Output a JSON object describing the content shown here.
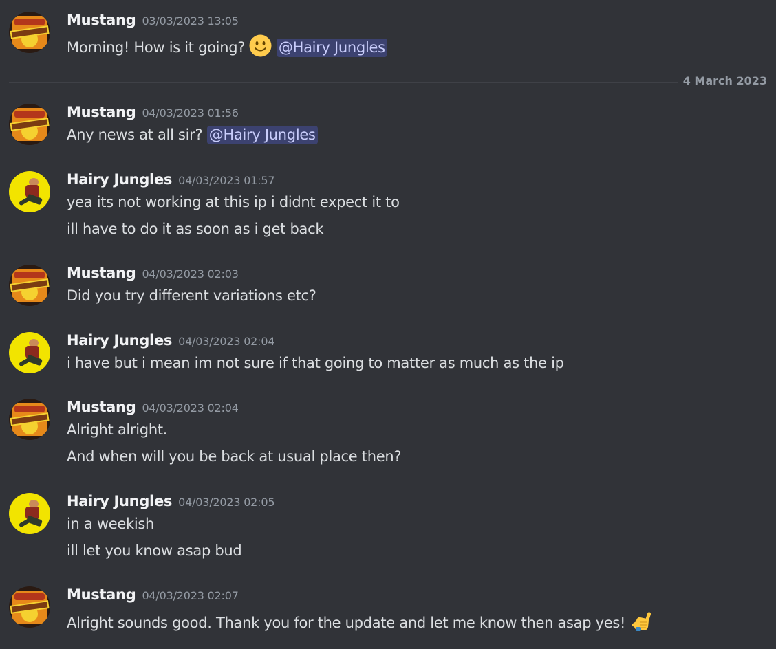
{
  "divider": {
    "label": "4 March 2023"
  },
  "mention_label": "@Hairy Jungles",
  "avatars": {
    "mustang_logo_text": "MUSTANG",
    "mustang_colors": [
      "#e6891a",
      "#f5d130",
      "#b3361b"
    ],
    "hairy_colors": [
      "#f2e400",
      "#8b2a1e",
      "#2f3a2a"
    ]
  },
  "messages": [
    {
      "author": "Mustang",
      "timestamp": "03/03/2023 13:05",
      "lines": [
        "Morning! How is it going?"
      ],
      "emoji": "slightly-smiling-face",
      "has_mention": true
    },
    {
      "author": "Mustang",
      "timestamp": "04/03/2023 01:56",
      "lines": [
        "Any news at all sir?"
      ],
      "has_mention": true
    },
    {
      "author": "Hairy Jungles",
      "timestamp": "04/03/2023 01:57",
      "lines": [
        "yea its not working at this ip i didnt expect it to",
        "ill have to do it as soon as i get back"
      ]
    },
    {
      "author": "Mustang",
      "timestamp": "04/03/2023 02:03",
      "lines": [
        "Did you try different variations etc?"
      ]
    },
    {
      "author": "Hairy Jungles",
      "timestamp": "04/03/2023 02:04",
      "lines": [
        "i have but i mean im not sure if that going to matter as much as the ip"
      ]
    },
    {
      "author": "Mustang",
      "timestamp": "04/03/2023 02:04",
      "lines": [
        "Alright alright.",
        "And when will you be back at usual place then?"
      ]
    },
    {
      "author": "Hairy Jungles",
      "timestamp": "04/03/2023 02:05",
      "lines": [
        "in a weekish",
        "ill let you know asap bud"
      ]
    },
    {
      "author": "Mustang",
      "timestamp": "04/03/2023 02:07",
      "lines": [
        "Alright sounds good. Thank you for the update and let me know then asap yes!"
      ],
      "emoji": "call-me-hand"
    }
  ]
}
